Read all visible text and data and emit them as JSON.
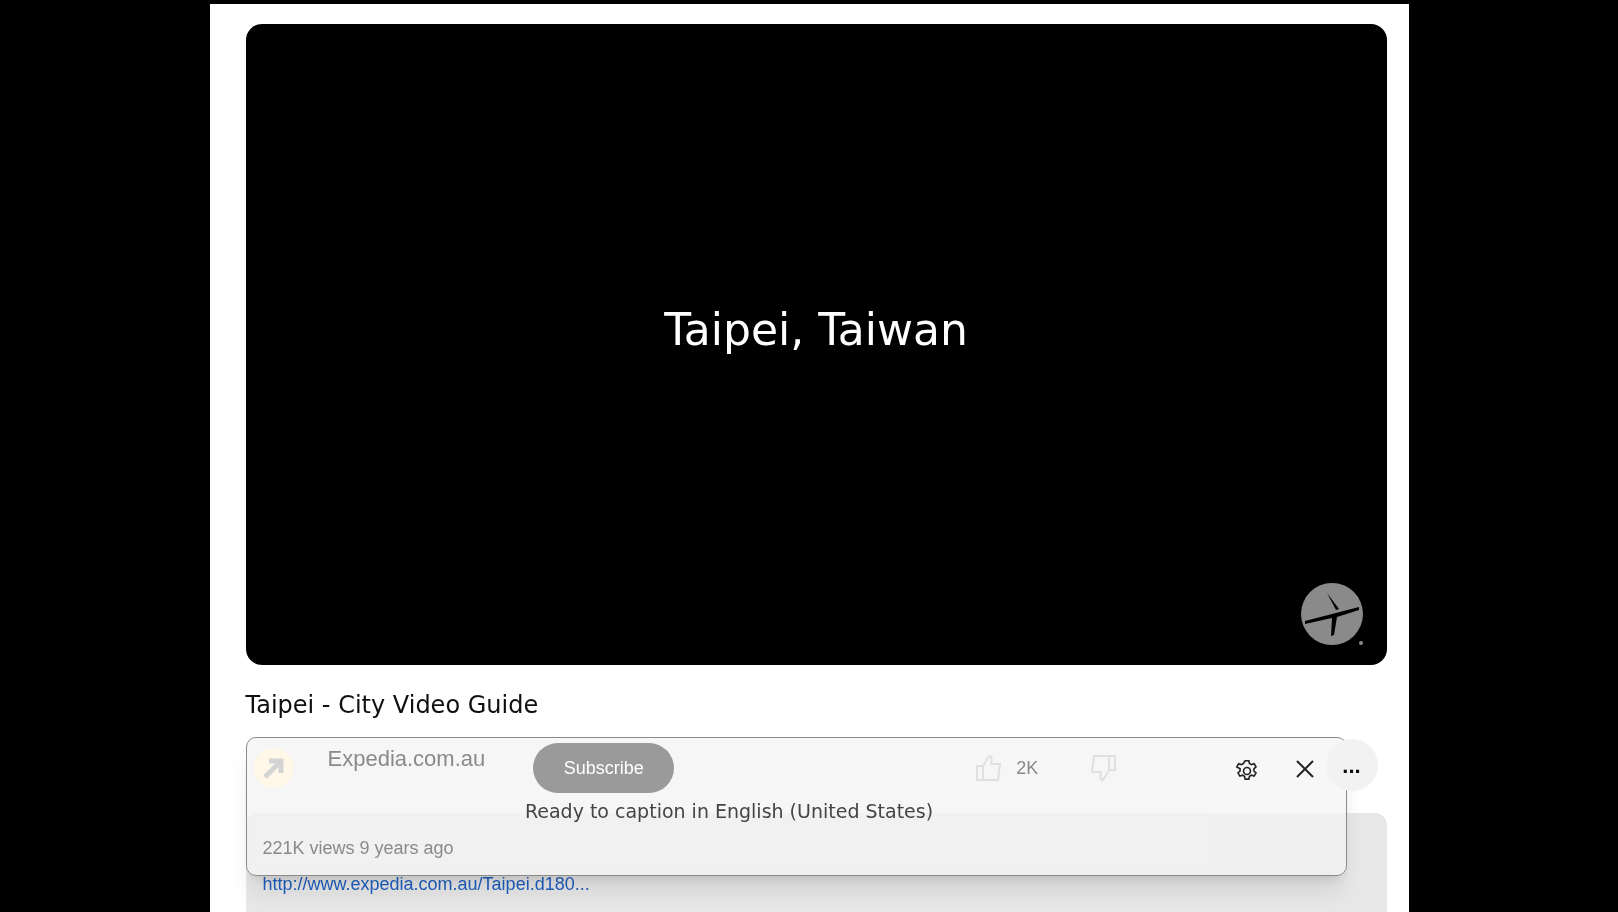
{
  "video": {
    "overlay_text": "Taipei, Taiwan"
  },
  "video_title": "Taipei - City Video Guide",
  "channel": {
    "name": "Expedia.com.au",
    "subscribe": "Subscribe",
    "likes": "2K"
  },
  "description": {
    "meta": "221K views 9 years ago",
    "link": "http://www.expedia.com.au/Taipei.d180..."
  },
  "caption_popup": {
    "message": "Ready to caption in English (United States)"
  },
  "more_button": "..."
}
